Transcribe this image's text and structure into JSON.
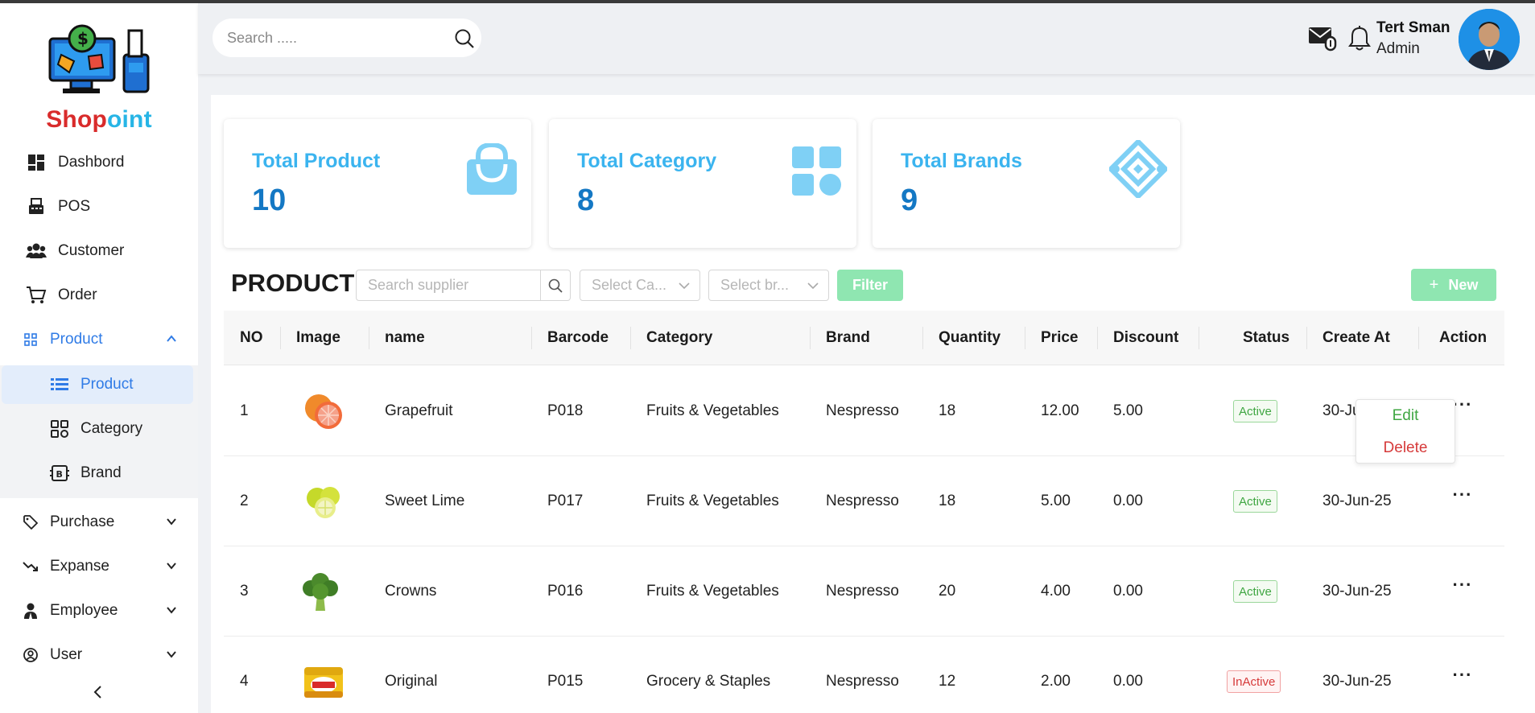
{
  "app": {
    "name_part1": "Shop",
    "name_part2": "oint"
  },
  "sidebar": {
    "items": [
      {
        "label": "Dashbord",
        "icon": "dashboard-icon"
      },
      {
        "label": "POS",
        "icon": "pos-icon"
      },
      {
        "label": "Customer",
        "icon": "users-icon"
      },
      {
        "label": "Order",
        "icon": "cart-icon"
      },
      {
        "label": "Product",
        "icon": "product-icon",
        "expanded": true
      },
      {
        "label": "Purchase",
        "icon": "tag-icon"
      },
      {
        "label": "Expanse",
        "icon": "trend-down-icon"
      },
      {
        "label": "Employee",
        "icon": "employee-icon"
      },
      {
        "label": "User",
        "icon": "user-circle-icon"
      }
    ],
    "product_sub": [
      {
        "label": "Product",
        "icon": "list-icon",
        "active": true
      },
      {
        "label": "Category",
        "icon": "category-icon"
      },
      {
        "label": "Brand",
        "icon": "brand-icon"
      }
    ],
    "collapse_label": "<"
  },
  "header": {
    "search_placeholder": "Search .....",
    "user": {
      "name": "Tert Sman",
      "role": "Admin"
    }
  },
  "stats": [
    {
      "title": "Total Product",
      "value": "10",
      "icon": "shopping-bag-icon"
    },
    {
      "title": "Total Category",
      "value": "8",
      "icon": "category-grid-icon"
    },
    {
      "title": "Total Brands",
      "value": "9",
      "icon": "brands-diamond-icon"
    }
  ],
  "colors": {
    "accent": "#2f7be6",
    "stat_title": "#3bb4ef",
    "stat_value": "#1478c4",
    "green_btn": "#8fe6b1",
    "brand_red": "#d92b2b",
    "brand_blue": "#27b5e6"
  },
  "product": {
    "title": "PRODUCT",
    "supplier_placeholder": "Search supplier",
    "category_placeholder": "Select Ca...",
    "brand_placeholder": "Select br...",
    "filter_label": "Filter",
    "new_label": "New",
    "columns": [
      "NO",
      "Image",
      "name",
      "Barcode",
      "Category",
      "Brand",
      "Quantity",
      "Price",
      "Discount",
      "Status",
      "Create At",
      "Action"
    ],
    "rows": [
      {
        "no": "1",
        "image": "grapefruit",
        "name": "Grapefruit",
        "barcode": "P018",
        "category": "Fruits & Vegetables",
        "brand": "Nespresso",
        "quantity": "18",
        "price": "12.00",
        "discount": "5.00",
        "status": "Active",
        "created": "30-Jun-25"
      },
      {
        "no": "2",
        "image": "sweet-lime",
        "name": "Sweet Lime",
        "barcode": "P017",
        "category": "Fruits & Vegetables",
        "brand": "Nespresso",
        "quantity": "18",
        "price": "5.00",
        "discount": "0.00",
        "status": "Active",
        "created": "30-Jun-25"
      },
      {
        "no": "3",
        "image": "broccoli",
        "name": "Crowns",
        "barcode": "P016",
        "category": "Fruits & Vegetables",
        "brand": "Nespresso",
        "quantity": "20",
        "price": "4.00",
        "discount": "0.00",
        "status": "Active",
        "created": "30-Jun-25"
      },
      {
        "no": "4",
        "image": "packaged-food",
        "name": "Original",
        "barcode": "P015",
        "category": "Grocery & Staples",
        "brand": "Nespresso",
        "quantity": "12",
        "price": "2.00",
        "discount": "0.00",
        "status": "InActive",
        "created": "30-Jun-25"
      }
    ],
    "row_menu": {
      "edit": "Edit",
      "delete": "Delete"
    }
  }
}
